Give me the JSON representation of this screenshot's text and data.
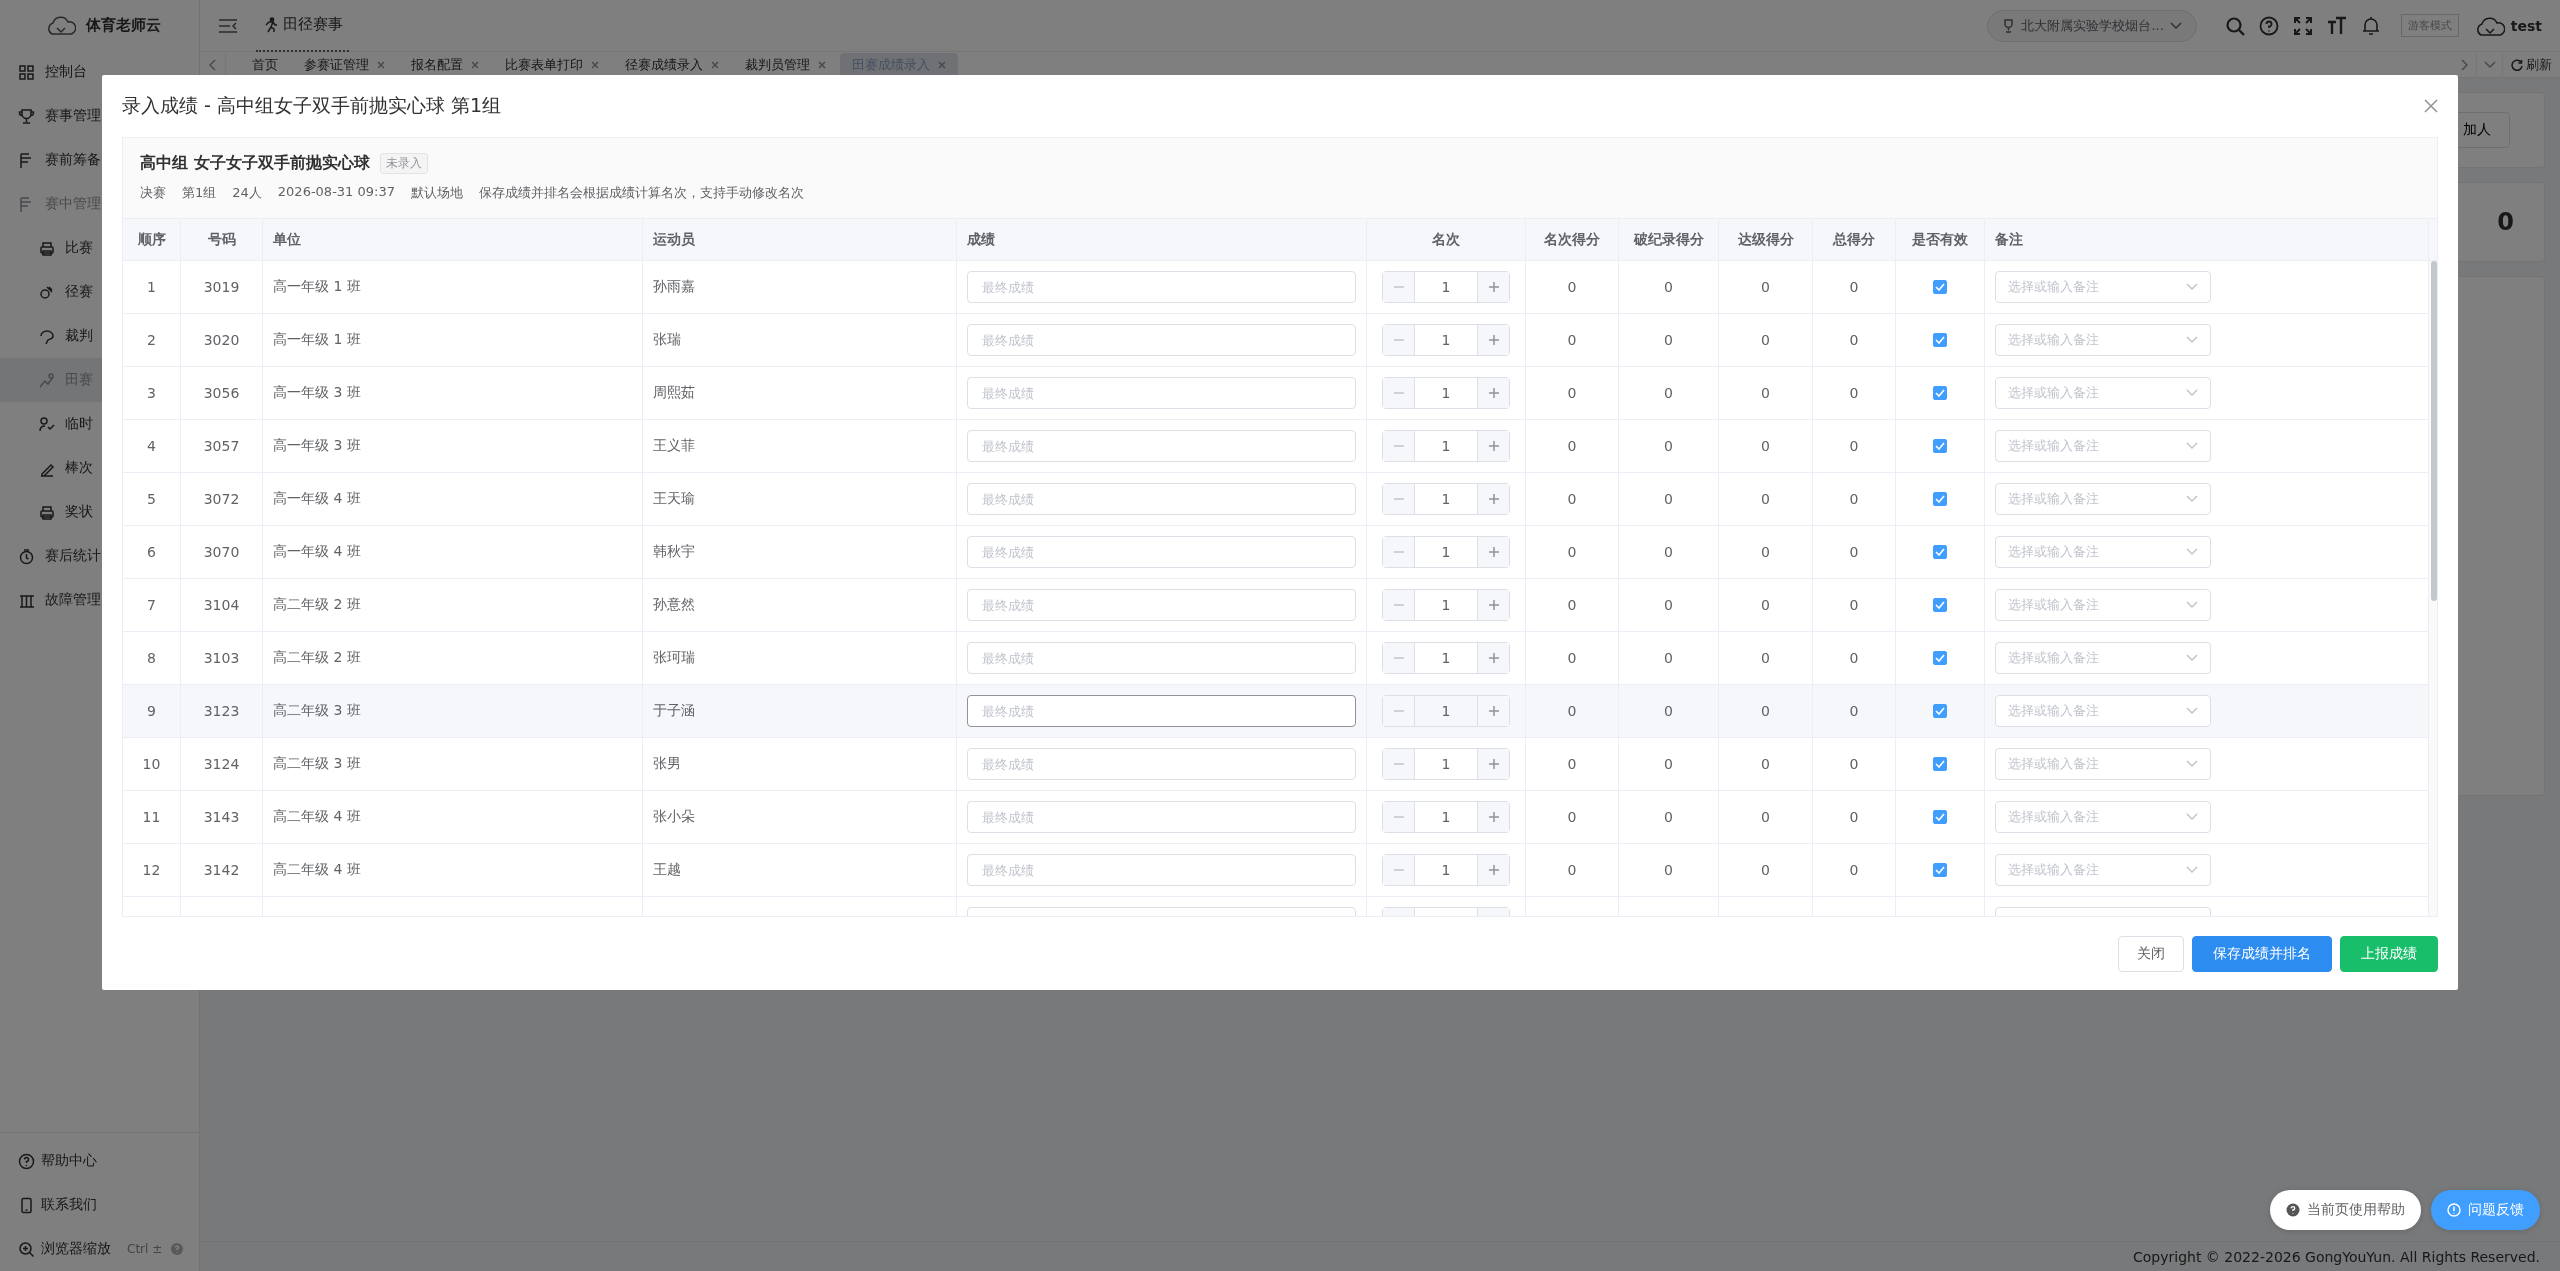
{
  "app": {
    "name": "体育老师云"
  },
  "sidebar": {
    "items": [
      {
        "label": "控制台",
        "expanded": false
      },
      {
        "label": "赛事管理",
        "expanded": false
      },
      {
        "label": "赛前筹备",
        "expanded": false
      },
      {
        "label": "赛中管理",
        "expanded": true,
        "children": [
          {
            "label": "比赛",
            "selected": false
          },
          {
            "label": "径赛",
            "selected": false
          },
          {
            "label": "裁判",
            "selected": false
          },
          {
            "label": "田赛",
            "selected": true
          },
          {
            "label": "临时",
            "selected": false
          },
          {
            "label": "棒次",
            "selected": false
          },
          {
            "label": "奖状",
            "selected": false
          }
        ]
      },
      {
        "label": "赛后统计",
        "expanded": false
      },
      {
        "label": "故障管理",
        "expanded": false
      }
    ],
    "footer": [
      {
        "label": "帮助中心"
      },
      {
        "label": "联系我们"
      },
      {
        "label": "浏览器缩放",
        "shortcut": "Ctrl ±"
      }
    ]
  },
  "header": {
    "module": "田径赛事",
    "school": "北大附属实验学校烟台...",
    "guest_badge": "游客模式",
    "user": "test"
  },
  "tabs": [
    {
      "label": "首页",
      "closable": false,
      "selected": false
    },
    {
      "label": "参赛证管理",
      "closable": true,
      "selected": false
    },
    {
      "label": "报名配置",
      "closable": true,
      "selected": false
    },
    {
      "label": "比赛表单打印",
      "closable": true,
      "selected": false
    },
    {
      "label": "径赛成绩录入",
      "closable": true,
      "selected": false
    },
    {
      "label": "裁判员管理",
      "closable": true,
      "selected": false
    },
    {
      "label": "田赛成绩录入",
      "closable": true,
      "selected": true
    }
  ],
  "tab_refresh": "刷新",
  "background": {
    "action_button": "加人",
    "stat_value": "0"
  },
  "dialog": {
    "title": "录入成绩 - 高中组女子双手前抛实心球 第1组",
    "event": {
      "title": "高中组 女子女子双手前抛实心球",
      "status": "未录入",
      "meta": [
        "决赛",
        "第1组",
        "24人",
        "2026-08-31 09:37",
        "默认场地",
        "保存成绩并排名会根据成绩计算名次，支持手动修改名次"
      ]
    },
    "columns": [
      "顺序",
      "号码",
      "单位",
      "运动员",
      "成绩",
      "名次",
      "名次得分",
      "破纪录得分",
      "达级得分",
      "总得分",
      "是否有效",
      "备注"
    ],
    "rows": [
      {
        "kind": "row",
        "order": "1",
        "number": "3019",
        "unit": "高一年级 1 班",
        "athlete": "孙雨嘉",
        "result_placeholder": "最终成绩",
        "rank": "1",
        "rank_score": "0",
        "record_score": "0",
        "grade_score": "0",
        "total": "0",
        "valid": true,
        "remark_placeholder": "选择或输入备注",
        "highlighted": false
      },
      {
        "kind": "row",
        "order": "2",
        "number": "3020",
        "unit": "高一年级 1 班",
        "athlete": "张瑞",
        "result_placeholder": "最终成绩",
        "rank": "1",
        "rank_score": "0",
        "record_score": "0",
        "grade_score": "0",
        "total": "0",
        "valid": true,
        "remark_placeholder": "选择或输入备注",
        "highlighted": false
      },
      {
        "kind": "row",
        "order": "3",
        "number": "3056",
        "unit": "高一年级 3 班",
        "athlete": "周熙茹",
        "result_placeholder": "最终成绩",
        "rank": "1",
        "rank_score": "0",
        "record_score": "0",
        "grade_score": "0",
        "total": "0",
        "valid": true,
        "remark_placeholder": "选择或输入备注",
        "highlighted": false
      },
      {
        "kind": "row",
        "order": "4",
        "number": "3057",
        "unit": "高一年级 3 班",
        "athlete": "王义菲",
        "result_placeholder": "最终成绩",
        "rank": "1",
        "rank_score": "0",
        "record_score": "0",
        "grade_score": "0",
        "total": "0",
        "valid": true,
        "remark_placeholder": "选择或输入备注",
        "highlighted": false
      },
      {
        "kind": "row",
        "order": "5",
        "number": "3072",
        "unit": "高一年级 4 班",
        "athlete": "王天瑜",
        "result_placeholder": "最终成绩",
        "rank": "1",
        "rank_score": "0",
        "record_score": "0",
        "grade_score": "0",
        "total": "0",
        "valid": true,
        "remark_placeholder": "选择或输入备注",
        "highlighted": false
      },
      {
        "kind": "row",
        "order": "6",
        "number": "3070",
        "unit": "高一年级 4 班",
        "athlete": "韩秋宇",
        "result_placeholder": "最终成绩",
        "rank": "1",
        "rank_score": "0",
        "record_score": "0",
        "grade_score": "0",
        "total": "0",
        "valid": true,
        "remark_placeholder": "选择或输入备注",
        "highlighted": false
      },
      {
        "kind": "row",
        "order": "7",
        "number": "3104",
        "unit": "高二年级 2 班",
        "athlete": "孙意然",
        "result_placeholder": "最终成绩",
        "rank": "1",
        "rank_score": "0",
        "record_score": "0",
        "grade_score": "0",
        "total": "0",
        "valid": true,
        "remark_placeholder": "选择或输入备注",
        "highlighted": false
      },
      {
        "kind": "row",
        "order": "8",
        "number": "3103",
        "unit": "高二年级 2 班",
        "athlete": "张珂瑞",
        "result_placeholder": "最终成绩",
        "rank": "1",
        "rank_score": "0",
        "record_score": "0",
        "grade_score": "0",
        "total": "0",
        "valid": true,
        "remark_placeholder": "选择或输入备注",
        "highlighted": false
      },
      {
        "kind": "row",
        "order": "9",
        "number": "3123",
        "unit": "高二年级 3 班",
        "athlete": "于子涵",
        "result_placeholder": "最终成绩",
        "rank": "1",
        "rank_score": "0",
        "record_score": "0",
        "grade_score": "0",
        "total": "0",
        "valid": true,
        "remark_placeholder": "选择或输入备注",
        "highlighted": true
      },
      {
        "kind": "row",
        "order": "10",
        "number": "3124",
        "unit": "高二年级 3 班",
        "athlete": "张男",
        "result_placeholder": "最终成绩",
        "rank": "1",
        "rank_score": "0",
        "record_score": "0",
        "grade_score": "0",
        "total": "0",
        "valid": true,
        "remark_placeholder": "选择或输入备注",
        "highlighted": false
      },
      {
        "kind": "row",
        "order": "11",
        "number": "3143",
        "unit": "高二年级 4 班",
        "athlete": "张小朵",
        "result_placeholder": "最终成绩",
        "rank": "1",
        "rank_score": "0",
        "record_score": "0",
        "grade_score": "0",
        "total": "0",
        "valid": true,
        "remark_placeholder": "选择或输入备注",
        "highlighted": false
      },
      {
        "kind": "row",
        "order": "12",
        "number": "3142",
        "unit": "高二年级 4 班",
        "athlete": "王越",
        "result_placeholder": "最终成绩",
        "rank": "1",
        "rank_score": "0",
        "record_score": "0",
        "grade_score": "0",
        "total": "0",
        "valid": true,
        "remark_placeholder": "选择或输入备注",
        "highlighted": false
      },
      {
        "kind": "cut_off"
      }
    ],
    "buttons": [
      {
        "label": "关闭",
        "kind": "default"
      },
      {
        "label": "保存成绩并排名",
        "kind": "primary"
      },
      {
        "label": "上报成绩",
        "kind": "success"
      }
    ]
  },
  "float_buttons": [
    {
      "label": "当前页使用帮助",
      "kind": "help"
    },
    {
      "label": "问题反馈",
      "kind": "feedback"
    }
  ],
  "copyright": "Copyright © 2022-2026 GongYouYun. All Rights Reserved."
}
